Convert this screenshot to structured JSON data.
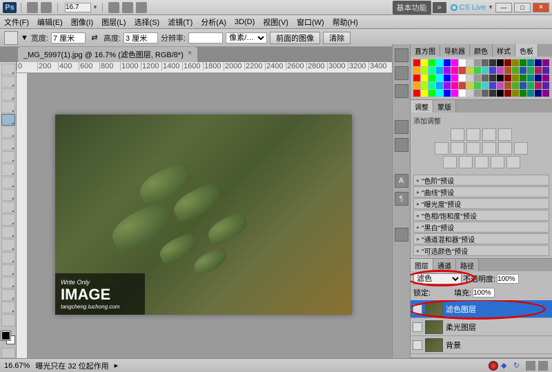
{
  "titlebar": {
    "zoom": "16.7",
    "workspace_label": "基本功能",
    "cslive": "CS Live"
  },
  "menu": [
    "文件(F)",
    "编辑(E)",
    "图像(I)",
    "图层(L)",
    "选择(S)",
    "滤镜(T)",
    "分析(A)",
    "3D(D)",
    "视图(V)",
    "窗口(W)",
    "帮助(H)"
  ],
  "optbar": {
    "width_label": "宽度:",
    "width_val": "7 厘米",
    "height_label": "高度:",
    "height_val": "3 厘米",
    "res_label": "分辨率:",
    "res_val": "",
    "res_unit": "像素/…",
    "front_btn": "前面的图像",
    "clear_btn": "清除"
  },
  "doc_tab": "_MG_5997(1).jpg @ 16.7% (滤色图层, RGB/8*)",
  "ruler_marks": [
    "0",
    "200",
    "400",
    "600",
    "800",
    "1000",
    "1200",
    "1400",
    "1600",
    "1800",
    "2000",
    "2200",
    "2400",
    "2600",
    "2800",
    "3000",
    "3200",
    "3400"
  ],
  "swatch_tabs": [
    "直方图",
    "导航器",
    "颜色",
    "样式",
    "色板"
  ],
  "adjust": {
    "tabs": [
      "调整",
      "蒙版"
    ],
    "title": "添加调整",
    "presets": [
      "\"色阶\"预设",
      "\"曲线\"预设",
      "\"曝光度\"预设",
      "\"色相/饱和度\"预设",
      "\"黑白\"预设",
      "\"通道混和器\"预设",
      "\"可选颜色\"预设"
    ]
  },
  "layers": {
    "tabs": [
      "图层",
      "通道",
      "路径"
    ],
    "blend_mode": "滤色",
    "opacity_label": "不透明度:",
    "opacity_val": "100%",
    "lock_label": "锁定:",
    "fill_label": "填充:",
    "fill_val": "100%",
    "rows": [
      {
        "name": "滤色图层",
        "selected": true
      },
      {
        "name": "柔光图层",
        "selected": false
      },
      {
        "name": "背景",
        "selected": false
      }
    ]
  },
  "status": {
    "zoom": "16.67%",
    "info": "曝光只在 32 位起作用"
  },
  "watermark": {
    "line1": "Write Only",
    "line2": "IMAGE",
    "line3": "tangcheng.tuchong.com"
  }
}
